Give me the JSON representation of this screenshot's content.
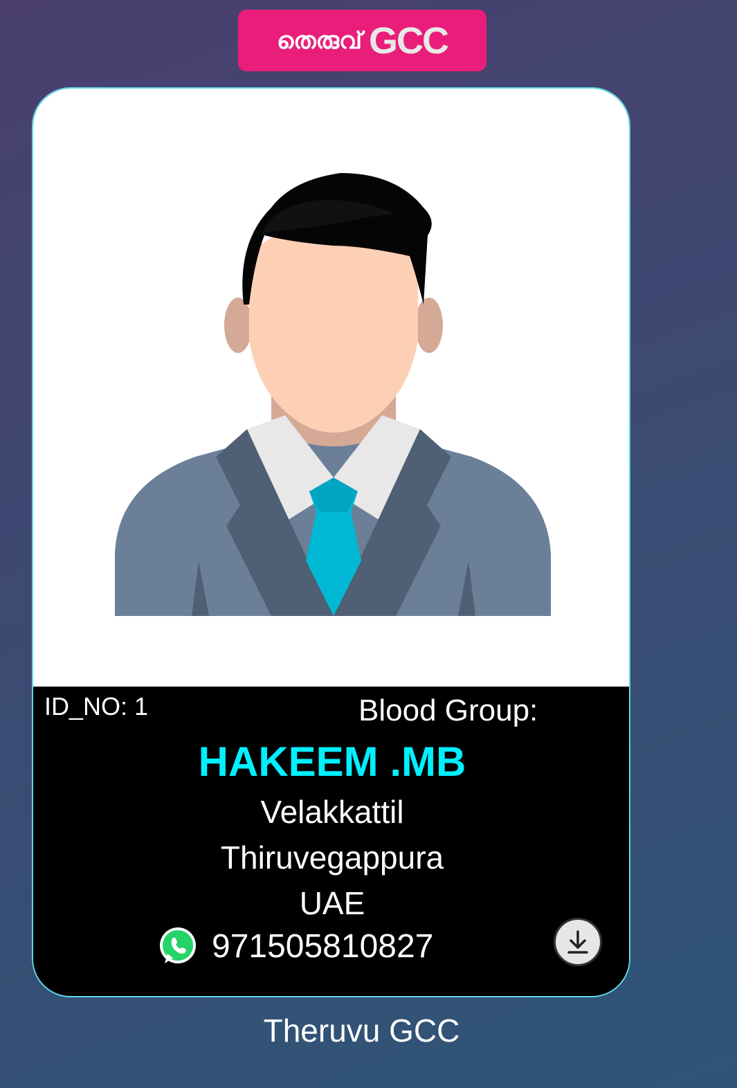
{
  "logo": {
    "malayalam": "തെരുവ്",
    "latin": "GCC"
  },
  "card": {
    "id_label": "ID_NO: 1",
    "blood_group_label": "Blood Group:",
    "name": "HAKEEM .MB",
    "address_line1": "Velakkattil",
    "address_line2": "Thiruvegappura",
    "address_line3": "UAE",
    "phone": "971505810827",
    "icons": {
      "whatsapp": "whatsapp-icon",
      "download": "download-icon",
      "avatar": "avatar-placeholder"
    }
  },
  "footer": {
    "text": "Theruvu GCC"
  },
  "colors": {
    "logo_bg": "#e91e7a",
    "name": "#00f0ff",
    "card_border": "#5fd7e8"
  }
}
